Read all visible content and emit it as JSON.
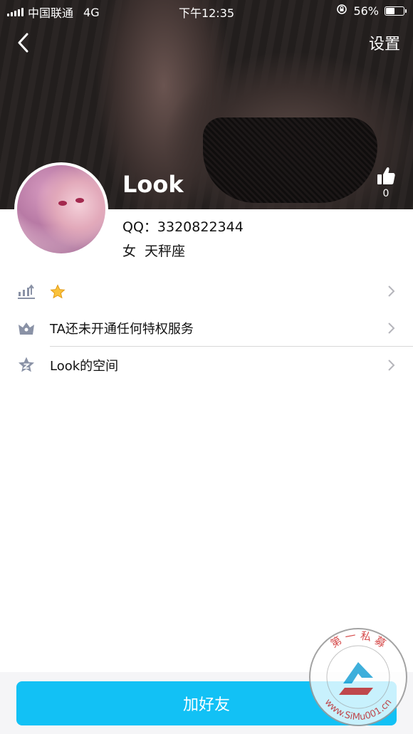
{
  "status_bar": {
    "carrier": "中国联通",
    "network": "4G",
    "time": "下午12:35",
    "battery_percent": "56%",
    "battery_level": 0.56
  },
  "nav": {
    "back_icon": "chevron-left-icon",
    "settings_label": "设置"
  },
  "profile": {
    "name": "Look",
    "like_count": "0",
    "qq": "QQ：3320822344",
    "gender": "女",
    "zodiac": "天秤座"
  },
  "list": {
    "items": [
      {
        "icon": "level-up-icon",
        "label": "",
        "badge": "star-icon"
      },
      {
        "icon": "crown-icon",
        "label": "TA还未开通任何特权服务"
      },
      {
        "icon": "star-z-icon",
        "label": "Look的空间"
      }
    ]
  },
  "action": {
    "add_friend_label": "加好友"
  },
  "watermark": {
    "text_top": "第 一 私 募",
    "text_bottom": "www.SiMu001.cn"
  },
  "colors": {
    "accent": "#12c1f5",
    "icon_gray": "#8a92a6",
    "chevron": "#b5b5bb"
  }
}
